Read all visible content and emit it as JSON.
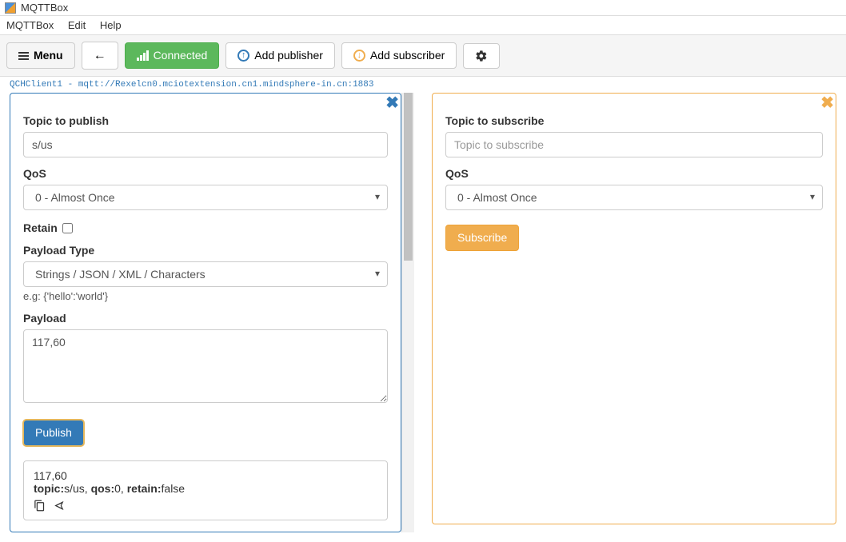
{
  "window": {
    "title": "MQTTBox"
  },
  "menubar": {
    "app": "MQTTBox",
    "edit": "Edit",
    "help": "Help"
  },
  "toolbar": {
    "menu": "Menu",
    "connected": "Connected",
    "add_publisher": "Add publisher",
    "add_subscriber": "Add subscriber"
  },
  "connection_line": "QCHClient1 - mqtt://Rexelcn0.mciotextension.cn1.mindsphere-in.cn:1883",
  "publish": {
    "topic_label": "Topic to publish",
    "topic_value": "s/us",
    "qos_label": "QoS",
    "qos_selected": "0 - Almost Once",
    "retain_label": "Retain",
    "retain_checked": false,
    "payload_type_label": "Payload Type",
    "payload_type_selected": "Strings / JSON / XML / Characters",
    "payload_type_hint": "e.g: {'hello':'world'}",
    "payload_label": "Payload",
    "payload_value": "117,60",
    "publish_btn": "Publish",
    "sent": {
      "payload": "117,60",
      "topic_key": "topic:",
      "topic_val": "s/us, ",
      "qos_key": "qos:",
      "qos_val": "0, ",
      "retain_key": "retain:",
      "retain_val": "false"
    }
  },
  "subscribe": {
    "topic_label": "Topic to subscribe",
    "topic_placeholder": "Topic to subscribe",
    "qos_label": "QoS",
    "qos_selected": "0 - Almost Once",
    "subscribe_btn": "Subscribe"
  }
}
